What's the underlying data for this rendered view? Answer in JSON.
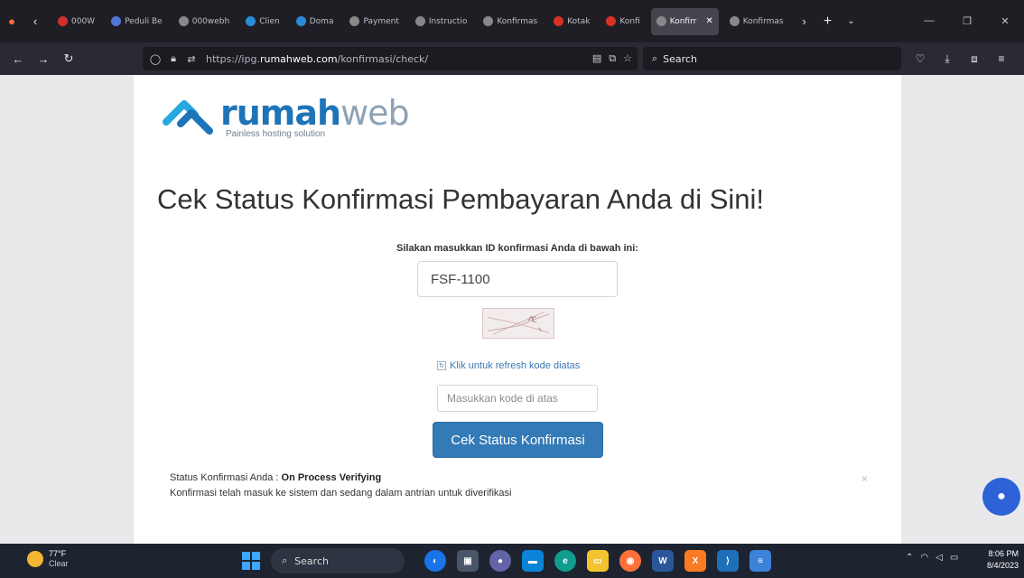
{
  "browser": {
    "tabs": [
      {
        "label": "000W",
        "color": "#d32f2f"
      },
      {
        "label": "Peduli Be",
        "color": "#4f78d6"
      },
      {
        "label": "000webh",
        "color": "#888888"
      },
      {
        "label": "Clien",
        "color": "#2a8bd8"
      },
      {
        "label": "Doma",
        "color": "#2a8bd8"
      },
      {
        "label": "Payment",
        "color": "#888888"
      },
      {
        "label": "Instructio",
        "color": "#888888"
      },
      {
        "label": "Konfirmas",
        "color": "#888888"
      },
      {
        "label": "Kotak",
        "color": "#d93025"
      },
      {
        "label": "Konfi",
        "color": "#d93025"
      },
      {
        "label": "Konfirr",
        "color": "#888888",
        "active": true
      },
      {
        "label": "Konfirmas",
        "color": "#888888"
      }
    ],
    "url_prefix": "https://ipg.",
    "url_domain": "rumahweb.com",
    "url_path": "/konfirmasi/check/",
    "search_placeholder": "Search"
  },
  "page": {
    "logo_brand_a": "rumah",
    "logo_brand_b": "web",
    "logo_tagline": "Painless hosting solution",
    "heading": "Cek Status Konfirmasi Pembayaran Anda di Sini!",
    "instruction": "Silakan masukkan ID konfirmasi Anda di bawah ini:",
    "confirmation_id_value": "FSF-1100",
    "refresh_text": "Klik untuk refresh kode diatas",
    "captcha_placeholder": "Masukkan kode di atas",
    "submit_label": "Cek Status Konfirmasi",
    "status_label": "Status Konfirmasi Anda : ",
    "status_value": "On Process Verifying",
    "status_message": "Konfirmasi telah masuk ke sistem dan sedang dalam antrian untuk diverifikasi",
    "status_close": "×"
  },
  "taskbar": {
    "weather_temp": "77°F",
    "weather_cond": "Clear",
    "search_label": "Search",
    "time": "8:06 PM",
    "date": "8/4/2023"
  },
  "colors": {
    "brand_blue": "#1e74b8",
    "button_blue": "#337ab7",
    "chat_blue": "#2d63d6"
  }
}
